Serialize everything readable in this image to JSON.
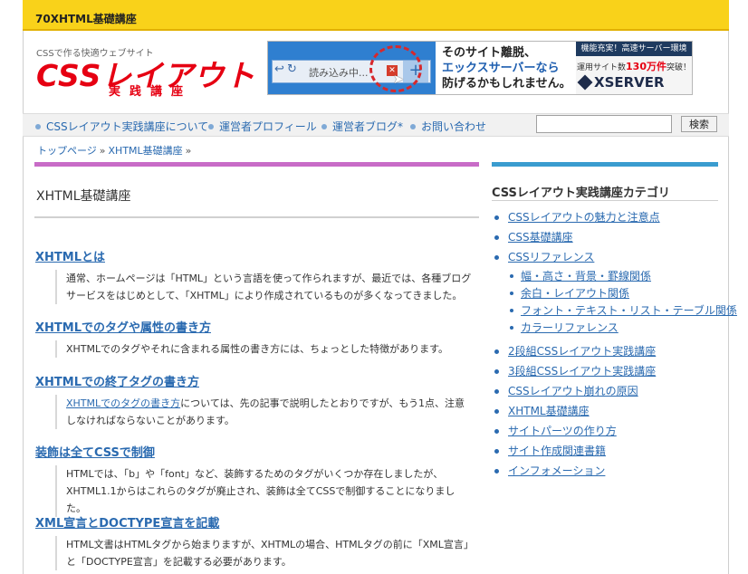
{
  "topbar": {
    "title": "70XHTML基礎講座"
  },
  "logo": {
    "tagline": "CSSで作る快適ウェブサイト",
    "main": "CSSレイアウト",
    "sub": "実践講座"
  },
  "ad": {
    "tab_text": "読み込み中...",
    "message_1": "そのサイト離脱、",
    "message_2": "エックスサーバーなら",
    "message_3": "防げるかもしれません。",
    "right_top": "機能充実！高速サーバー環境",
    "right_mid_prefix": "運用サイト数",
    "right_mid_num": "130万件",
    "right_mid_suffix": "突破！",
    "brand": "XSERVER"
  },
  "nav": {
    "items": [
      {
        "label": "CSSレイアウト実践講座について"
      },
      {
        "label": "運営者プロフィール"
      },
      {
        "label": "運営者ブログ*"
      },
      {
        "label": "お問い合わせ"
      }
    ],
    "search_value": "",
    "search_button": "検索"
  },
  "breadcrumb": {
    "home": "トップページ",
    "current": "XHTML基礎講座",
    "sep": "»"
  },
  "main": {
    "title": "XHTML基礎講座",
    "articles": [
      {
        "title": "XHTMLとは",
        "body": "通常、ホームページは「HTML」という言語を使って作られますが、最近では、各種ブログサービスをはじめとして、「XHTML」により作成されているものが多くなってきました。"
      },
      {
        "title": "XHTMLでのタグや属性の書き方",
        "body": "XHTMLでのタグやそれに含まれる属性の書き方には、ちょっとした特徴があります。"
      },
      {
        "title": "XHTMLでの終了タグの書き方",
        "link": "XHTMLでのタグの書き方",
        "body": "については、先の記事で説明したとおりですが、もう1点、注意しなければならないことがあります。"
      },
      {
        "title": "装飾は全てCSSで制御",
        "body": "HTMLでは、「b」や「font」など、装飾するためのタグがいくつか存在しましたが、XHTML1.1からはこれらのタグが廃止され、装飾は全てCSSで制御することになりました。"
      },
      {
        "title": "XML宣言とDOCTYPE宣言を記載",
        "body": "HTML文書はHTMLタグから始まりますが、XHTMLの場合、HTMLタグの前に「XML宣言」と「DOCTYPE宣言」を記載する必要があります。"
      }
    ]
  },
  "sidebar": {
    "heading": "CSSレイアウト実践講座カテゴリ",
    "items": [
      {
        "label": "CSSレイアウトの魅力と注意点"
      },
      {
        "label": "CSS基礎講座"
      },
      {
        "label": "CSSリファレンス"
      },
      {
        "label": "2段組CSSレイアウト実践講座"
      },
      {
        "label": "3段組CSSレイアウト実践講座"
      },
      {
        "label": "CSSレイアウト崩れの原因"
      },
      {
        "label": "XHTML基礎講座"
      },
      {
        "label": "サイトパーツの作り方"
      },
      {
        "label": "サイト作成関連書籍"
      },
      {
        "label": "インフォメーション"
      }
    ],
    "subitems": [
      {
        "label": "幅・高さ・背景・罫線関係"
      },
      {
        "label": "余白・レイアウト関係"
      },
      {
        "label": "フォント・テキスト・リスト・テーブル関係"
      },
      {
        "label": "カラーリファレンス"
      }
    ]
  }
}
